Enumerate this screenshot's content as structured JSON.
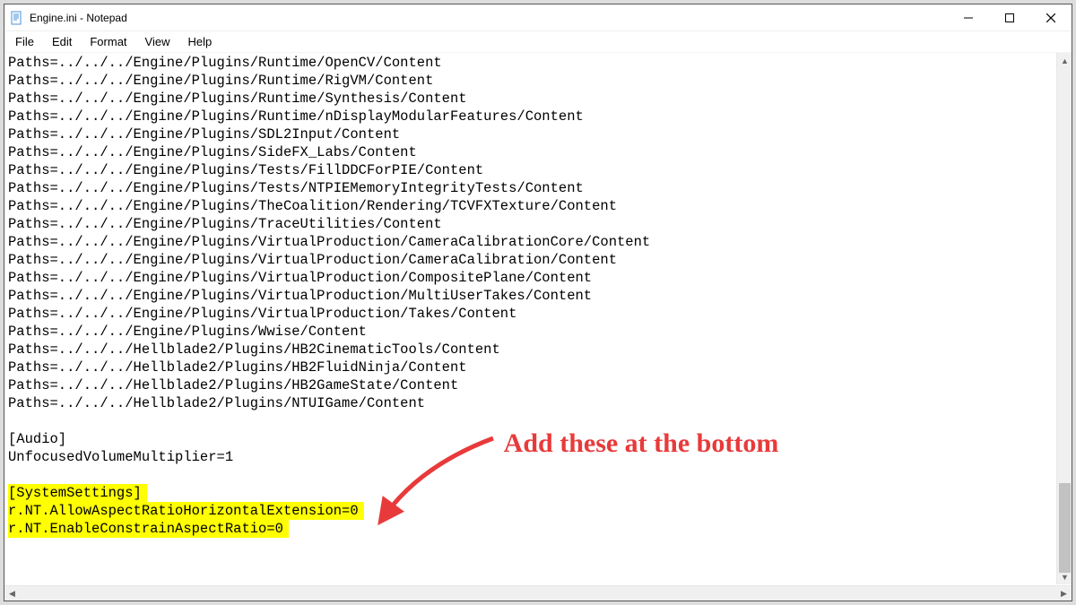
{
  "window": {
    "title": "Engine.ini - Notepad"
  },
  "menu": {
    "file": "File",
    "edit": "Edit",
    "format": "Format",
    "view": "View",
    "help": "Help"
  },
  "content": {
    "lines": [
      "Paths=../../../Engine/Plugins/Runtime/OpenCV/Content",
      "Paths=../../../Engine/Plugins/Runtime/RigVM/Content",
      "Paths=../../../Engine/Plugins/Runtime/Synthesis/Content",
      "Paths=../../../Engine/Plugins/Runtime/nDisplayModularFeatures/Content",
      "Paths=../../../Engine/Plugins/SDL2Input/Content",
      "Paths=../../../Engine/Plugins/SideFX_Labs/Content",
      "Paths=../../../Engine/Plugins/Tests/FillDDCForPIE/Content",
      "Paths=../../../Engine/Plugins/Tests/NTPIEMemoryIntegrityTests/Content",
      "Paths=../../../Engine/Plugins/TheCoalition/Rendering/TCVFXTexture/Content",
      "Paths=../../../Engine/Plugins/TraceUtilities/Content",
      "Paths=../../../Engine/Plugins/VirtualProduction/CameraCalibrationCore/Content",
      "Paths=../../../Engine/Plugins/VirtualProduction/CameraCalibration/Content",
      "Paths=../../../Engine/Plugins/VirtualProduction/CompositePlane/Content",
      "Paths=../../../Engine/Plugins/VirtualProduction/MultiUserTakes/Content",
      "Paths=../../../Engine/Plugins/VirtualProduction/Takes/Content",
      "Paths=../../../Engine/Plugins/Wwise/Content",
      "Paths=../../../Hellblade2/Plugins/HB2CinematicTools/Content",
      "Paths=../../../Hellblade2/Plugins/HB2FluidNinja/Content",
      "Paths=../../../Hellblade2/Plugins/HB2GameState/Content",
      "Paths=../../../Hellblade2/Plugins/NTUIGame/Content",
      "",
      "[Audio]",
      "UnfocusedVolumeMultiplier=1",
      ""
    ],
    "highlighted": [
      "[SystemSettings]",
      "r.NT.AllowAspectRatioHorizontalExtension=0",
      "r.NT.EnableConstrainAspectRatio=0"
    ]
  },
  "annotation": {
    "text": "Add these at the\nbottom"
  }
}
